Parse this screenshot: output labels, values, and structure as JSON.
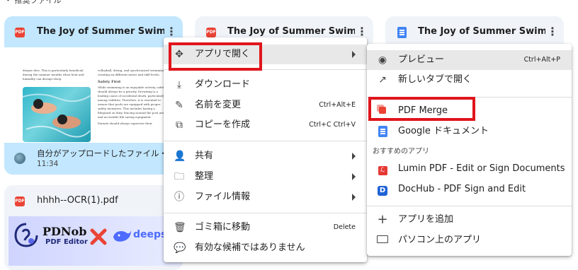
{
  "top_label": "・ 推奨ファイル",
  "cards": [
    {
      "title": "The Joy of Summer Swimming...",
      "caption": "自分がアップロードしたファイル・",
      "time": "11:34"
    },
    {
      "title": "The Joy of Summer Swimming(..."
    },
    {
      "title": "The Joy of Summer Swimming..."
    },
    {
      "title": "hhhh--OCR(1).pdf"
    }
  ],
  "thumb_text": {
    "left_col": "deeper dive. This is particularly beneficial during the summer months when heat and humidity can disrupt sleep.",
    "right_col_a": "volleyball, diving, and synchronized swimming, creating an different motor and skill levels.",
    "right_heading": "Safety First",
    "right_col_b": "While swimming is an enjoyable activity, safety should always be a priority. Drowning is a leading cause of accidental death, particularly among children. Therefore, it is essential to ensure that pools are equipped with proper safety measures. This includes having a lifeguard on duty, fencing around the pool area, and accessible life-saving equipment.",
    "right_col_c": "Parents should always supervise their"
  },
  "pdnob": {
    "brand": "PDNob",
    "sub": "PDF Editor",
    "partner": "deepse"
  },
  "context_menu": {
    "items": [
      {
        "label": "アプリで開く",
        "icon": "open-with-icon"
      },
      {
        "label": "ダウンロード",
        "icon": "download-icon"
      },
      {
        "label": "名前を変更",
        "icon": "rename-icon",
        "shortcut": "Ctrl+Alt+E"
      },
      {
        "label": "コピーを作成",
        "icon": "copy-icon",
        "shortcut": "Ctrl+C Ctrl+V"
      },
      {
        "label": "共有",
        "icon": "share-icon"
      },
      {
        "label": "整理",
        "icon": "folder-icon"
      },
      {
        "label": "ファイル情報",
        "icon": "info-icon"
      },
      {
        "label": "ゴミ箱に移動",
        "icon": "trash-icon",
        "shortcut": "Delete"
      },
      {
        "label": "有効な候補ではありません",
        "icon": "feedback-icon"
      }
    ]
  },
  "submenu": {
    "preview": {
      "label": "プレビュー",
      "shortcut": "Ctrl+Alt+P"
    },
    "new_tab": "新しいタブで開く",
    "pdf_merge": "PDF Merge",
    "google_docs": "Google ドキュメント",
    "section_label": "おすすめのアプリ",
    "lumin": "Lumin PDF - Edit or Sign Documents",
    "dochub": "DocHub - PDF Sign and Edit",
    "add_app": "アプリを追加",
    "computer_apps": "パソコン上のアプリ"
  },
  "colors": {
    "highlight_box": "#e0151c",
    "selected_card": "#c2e7ff",
    "pdf_red": "#ea4335",
    "doc_blue": "#4285f4"
  }
}
